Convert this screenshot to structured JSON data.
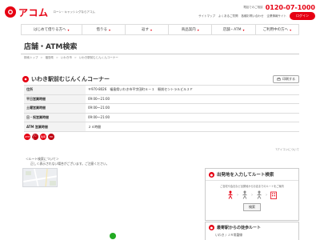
{
  "header": {
    "brand": "アコム",
    "tagline": "ローン・キャッシングならアコム",
    "tel_label": "電話でのご相談",
    "tel_number": "0120-07-1000",
    "links": [
      "サイトマップ",
      "よくあるご質問",
      "各種お問い合わせ",
      "企業情報サイト"
    ],
    "login_label": "ログイン"
  },
  "nav": [
    {
      "label": "はじめて借りる方へ"
    },
    {
      "label": "借りる"
    },
    {
      "label": "返す"
    },
    {
      "label": "商品案内"
    },
    {
      "label": "店舗・ATM"
    },
    {
      "label": "ご利用中の方へ"
    }
  ],
  "page_title": "店舗・ATM検索",
  "breadcrumb": [
    "検索トップ",
    "福島県",
    "いわき市",
    "いわき駅前むじんくんコーナー"
  ],
  "breadcrumb_sep": ">",
  "store": {
    "name": "いわき駅前むじんくんコーナー",
    "print_label": "印刷する",
    "rows": [
      {
        "key": "住所",
        "value": "〒970-8026　福島県いわき市平字田町６－１　駅前セントラルビル２Ｆ"
      },
      {
        "key": "平日営業時間",
        "value": "09:00～21:00"
      },
      {
        "key": "土曜営業時間",
        "value": "09:00～21:00"
      },
      {
        "key": "日・祝営業時間",
        "value": "09:00～21:00"
      },
      {
        "key": "ATM 営業時間",
        "value": "２４時間"
      }
    ],
    "icons": [
      "ATM",
      "むじん",
      "駐車",
      "HD"
    ],
    "icon_desc_link": "アイコンについて"
  },
  "route_note": "＜ルート検索について＞",
  "route_warn": "正しく表示されない場合がございます。ご注意ください。",
  "route_search": {
    "title": "出発地を入力してルート検索",
    "subtitle": "ご自宅や会社など出発地からお店までのルートをご案内",
    "button": "検索"
  },
  "nearest": {
    "title": "最寄駅からの徒歩ルート",
    "station": "いわき / ＪＲ常磐線"
  },
  "colors": {
    "brand": "#e60012"
  }
}
